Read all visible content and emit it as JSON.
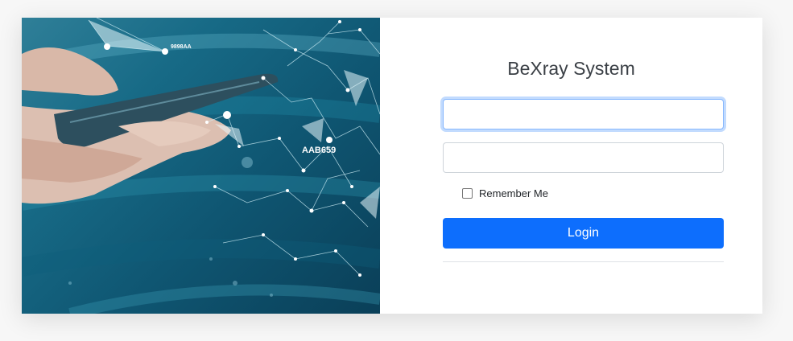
{
  "login": {
    "title": "BeXray System",
    "username_value": "",
    "password_value": "",
    "remember_label": "Remember Me",
    "login_label": "Login"
  },
  "hero": {
    "tag_small": "9898AA",
    "tag_large": "AAB659"
  },
  "colors": {
    "accent": "#0d6efd",
    "hero_teal": "#176a86"
  }
}
